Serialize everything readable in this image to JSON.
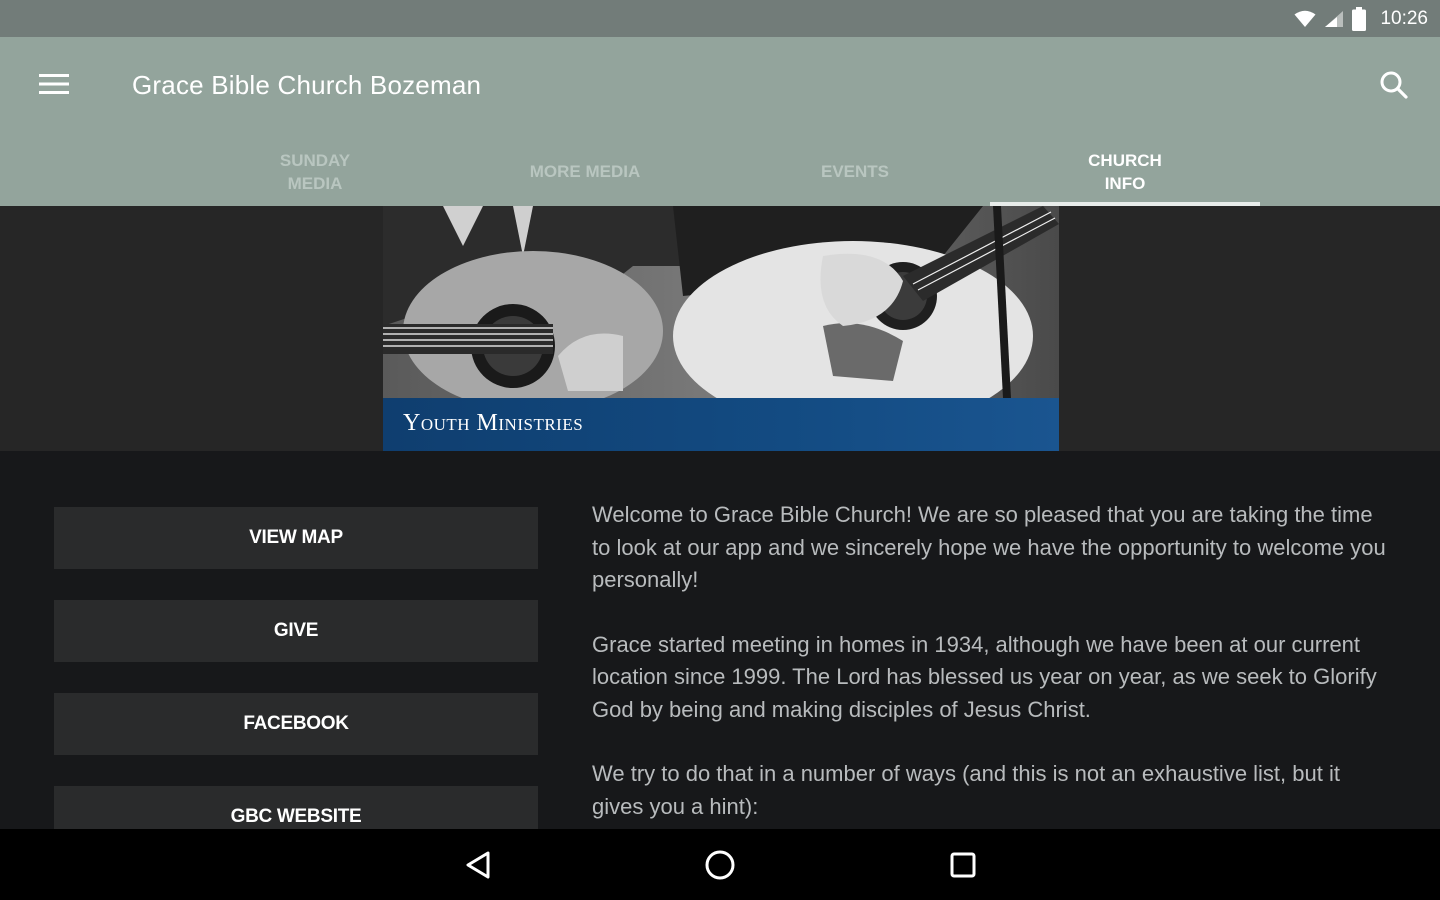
{
  "status_bar": {
    "time": "10:26",
    "icons": [
      "wifi-icon",
      "cellular-signal-icon",
      "battery-icon"
    ]
  },
  "app_bar": {
    "title": "Grace Bible Church Bozeman",
    "menu_icon": "menu-icon",
    "search_icon": "search-icon",
    "background_color": "#93a49c"
  },
  "tabs": [
    {
      "label": "SUNDAY\nMEDIA",
      "active": false
    },
    {
      "label": "MORE MEDIA",
      "active": false
    },
    {
      "label": "EVENTS",
      "active": false
    },
    {
      "label": "CHURCH\nINFO",
      "active": true
    }
  ],
  "banner": {
    "caption": "Youth Ministries",
    "caption_color": "#134b82"
  },
  "buttons": [
    {
      "label": "VIEW MAP"
    },
    {
      "label": "GIVE"
    },
    {
      "label": "FACEBOOK"
    },
    {
      "label": "GBC WEBSITE"
    }
  ],
  "church_info": {
    "paragraphs": [
      "Welcome to Grace Bible Church!  We are so pleased that you are taking the time to look at our app and we sincerely hope we have the opportunity to welcome you personally!",
      "Grace started meeting in homes in 1934, although we have been at our current location since 1999.  The Lord has blessed us year on year, as we seek to Glorify God by being and making disciples of Jesus Christ.",
      "We try to do that in a number of ways (and this is not an exhaustive list, but it gives you a hint):"
    ]
  },
  "nav_bar": {
    "buttons": [
      "back-icon",
      "home-icon",
      "recents-icon"
    ]
  }
}
